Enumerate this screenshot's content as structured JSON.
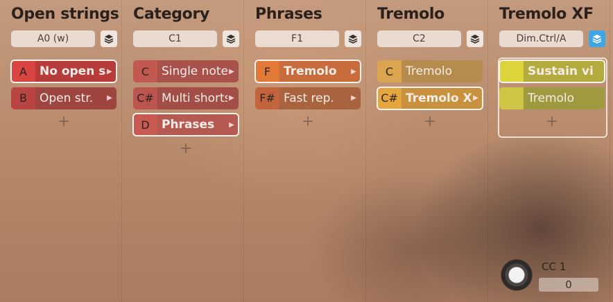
{
  "columns": [
    {
      "title": "Open strings",
      "selector": "A0 (w)",
      "layers_active": false,
      "articulations": [
        {
          "key": "A",
          "name": "No open str",
          "arrow": "▶",
          "selected": true,
          "bold": true,
          "key_color": "#d8443f",
          "name_color": "#b63b3a"
        },
        {
          "key": "B",
          "name": "Open str.",
          "arrow": "▶",
          "selected": false,
          "bold": false,
          "key_color": "#b94442",
          "name_color": "#9f4540"
        }
      ],
      "add": "+"
    },
    {
      "title": "Category",
      "selector": "C1",
      "layers_active": false,
      "articulations": [
        {
          "key": "C",
          "name": "Single notes",
          "arrow": "▶",
          "selected": false,
          "bold": false,
          "key_color": "#c2584f",
          "name_color": "#a9524b"
        },
        {
          "key": "C#",
          "name": "Multi shorts",
          "arrow": "▶",
          "selected": false,
          "bold": false,
          "key_color": "#bb554d",
          "name_color": "#a24e47"
        },
        {
          "key": "D",
          "name": "Phrases",
          "arrow": "▶",
          "selected": true,
          "bold": true,
          "key_color": "#c95a51",
          "name_color": "#b65a51"
        }
      ],
      "add": "+"
    },
    {
      "title": "Phrases",
      "selector": "F1",
      "layers_active": false,
      "articulations": [
        {
          "key": "F",
          "name": "Tremolo",
          "arrow": "▶",
          "selected": true,
          "bold": true,
          "key_color": "#e27937",
          "name_color": "#c96c3d"
        },
        {
          "key": "F#",
          "name": "Fast rep.",
          "arrow": "▶",
          "selected": false,
          "bold": false,
          "key_color": "#c2653d",
          "name_color": "#a9633f"
        }
      ],
      "add": "+"
    },
    {
      "title": "Tremolo",
      "selector": "C2",
      "layers_active": false,
      "articulations": [
        {
          "key": "C",
          "name": "Tremolo",
          "arrow": "",
          "selected": false,
          "bold": false,
          "key_color": "#dba44f",
          "name_color": "#b58c4e"
        },
        {
          "key": "C#",
          "name": "Tremolo XF",
          "arrow": "▶",
          "selected": true,
          "bold": true,
          "key_color": "#e6a63f",
          "name_color": "#c9913e"
        }
      ],
      "add": "+"
    },
    {
      "title": "Tremolo XF",
      "selector": "Dim.Ctrl/A",
      "layers_active": true,
      "articulations": [
        {
          "key": "",
          "name": "Sustain vib.",
          "arrow": "",
          "selected": true,
          "bold": true,
          "key_color": "#ddd43c",
          "name_color": "#b3ab3d"
        },
        {
          "key": "",
          "name": "Tremolo",
          "arrow": "",
          "selected": false,
          "bold": false,
          "key_color": "#cfc545",
          "name_color": "#9f9a3f"
        }
      ],
      "add": "+"
    }
  ],
  "cc": {
    "label": "CC 1",
    "value": "0"
  },
  "icons": {
    "layers": "layers-icon",
    "knob": "knob-icon",
    "add": "plus-icon",
    "arrow": "chevron-right-icon"
  }
}
